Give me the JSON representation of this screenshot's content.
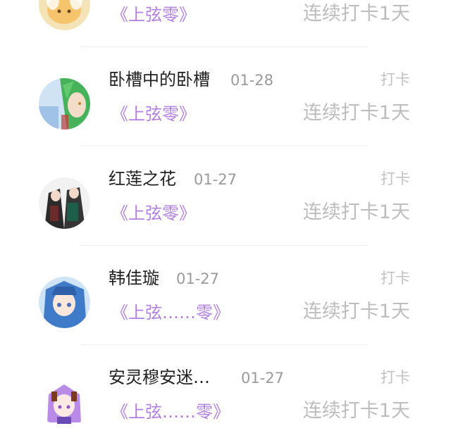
{
  "entries": [
    {
      "user": "",
      "date": "",
      "label": "",
      "book": "《上弦零》",
      "streak": "连续打卡1天",
      "avatar_icon": "cartoon-avatar"
    },
    {
      "user": "卧槽中的卧槽",
      "date": "01-28",
      "label": "打卡",
      "book": "《上弦零》",
      "streak": "连续打卡1天",
      "avatar_icon": "anime-avatar"
    },
    {
      "user": "红莲之花",
      "date": "01-27",
      "label": "打卡",
      "book": "《上弦零》",
      "streak": "连续打卡1天",
      "avatar_icon": "anime-avatar"
    },
    {
      "user": "韩佳璇",
      "date": "01-27",
      "label": "打卡",
      "book": "《上弦……零》",
      "streak": "连续打卡1天",
      "avatar_icon": "anime-avatar"
    },
    {
      "user": "安灵穆安迷…",
      "date": "01-27",
      "label": "打卡",
      "book": "《上弦……零》",
      "streak": "连续打卡1天",
      "avatar_icon": "anime-avatar"
    }
  ],
  "colors": {
    "book_title": "#b07fe0",
    "streak_text": "#bdbdbd",
    "username": "#222222",
    "date_text": "#9a9a9a"
  }
}
